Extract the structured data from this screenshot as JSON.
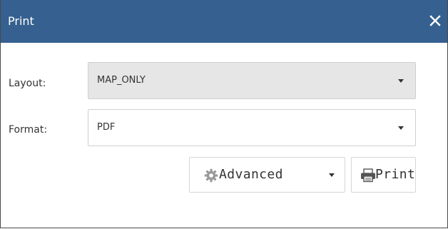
{
  "dialog": {
    "title": "Print",
    "close_icon": "close-icon",
    "colors": {
      "titlebar": "#35608f",
      "title_text": "#ffffff",
      "disabled_select": "#e6e6e6"
    }
  },
  "form": {
    "layout": {
      "label": "Layout:",
      "value": "MAP_ONLY",
      "disabled": true
    },
    "format": {
      "label": "Format:",
      "value": "PDF"
    }
  },
  "actions": {
    "advanced": {
      "label": "Advanced",
      "icon": "gear-icon"
    },
    "print": {
      "label": "Print",
      "icon": "printer-icon"
    }
  }
}
